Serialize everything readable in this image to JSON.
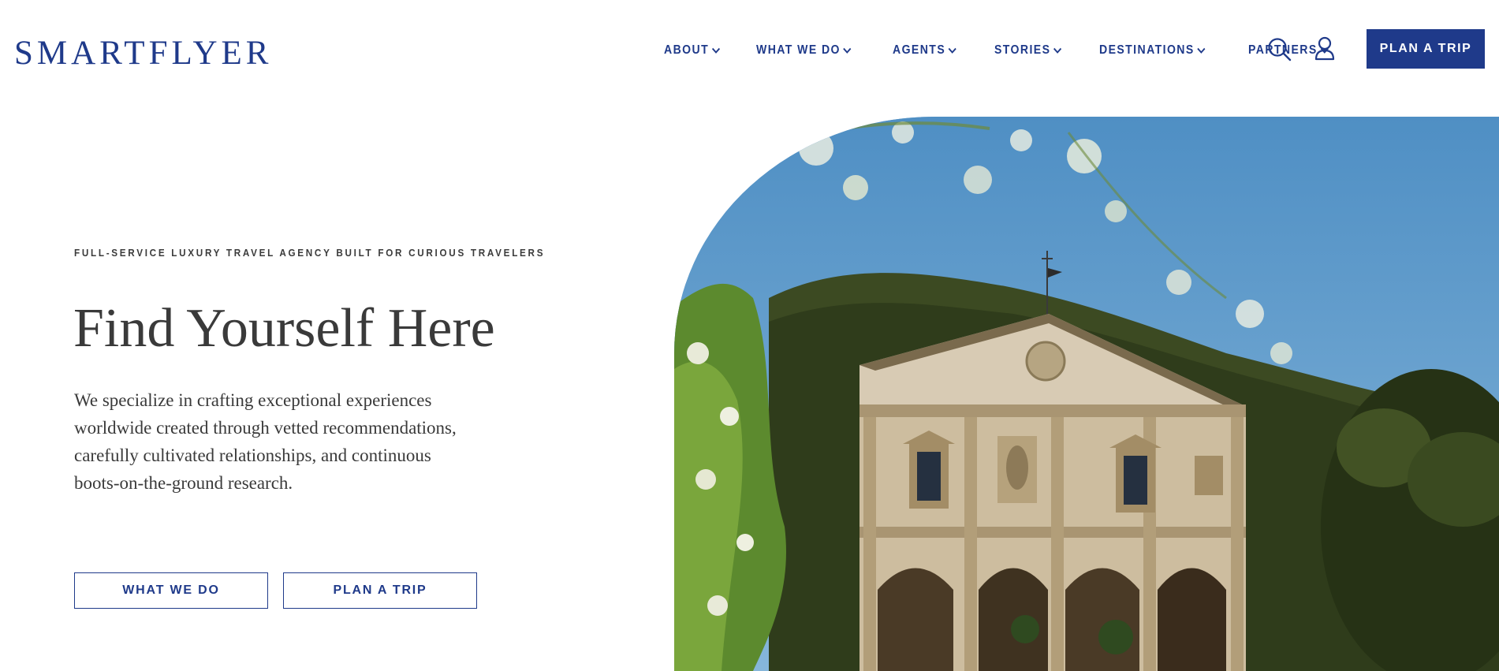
{
  "brand": {
    "logo_text": "SMARTFLYER",
    "primary_color": "#1f3a8a"
  },
  "nav": {
    "items": [
      {
        "label": "ABOUT",
        "icon": "chevron-down-icon"
      },
      {
        "label": "WHAT WE DO",
        "icon": "chevron-down-icon"
      },
      {
        "label": "AGENTS",
        "icon": "chevron-down-icon"
      },
      {
        "label": "STORIES",
        "icon": "chevron-down-icon"
      },
      {
        "label": "DESTINATIONS",
        "icon": "chevron-down-icon"
      },
      {
        "label": "PARTNERS",
        "icon": "chevron-down-icon"
      }
    ],
    "search_icon": "search-icon",
    "account_icon": "user-icon",
    "cta_label": "PLAN A TRIP"
  },
  "hero": {
    "eyebrow": "FULL-SERVICE LUXURY TRAVEL AGENCY BUILT FOR CURIOUS TRAVELERS",
    "title": "Find Yourself Here",
    "description": "We specialize in crafting exceptional experiences worldwide created through vetted recommendations, carefully cultivated relationships, and continuous boots-on-the-ground research.",
    "buttons": [
      {
        "label": "WHAT WE DO"
      },
      {
        "label": "PLAN A TRIP"
      }
    ],
    "image_subject": "Italian villa facade with arched loggia, hillside trees and flowering branches under blue sky"
  }
}
